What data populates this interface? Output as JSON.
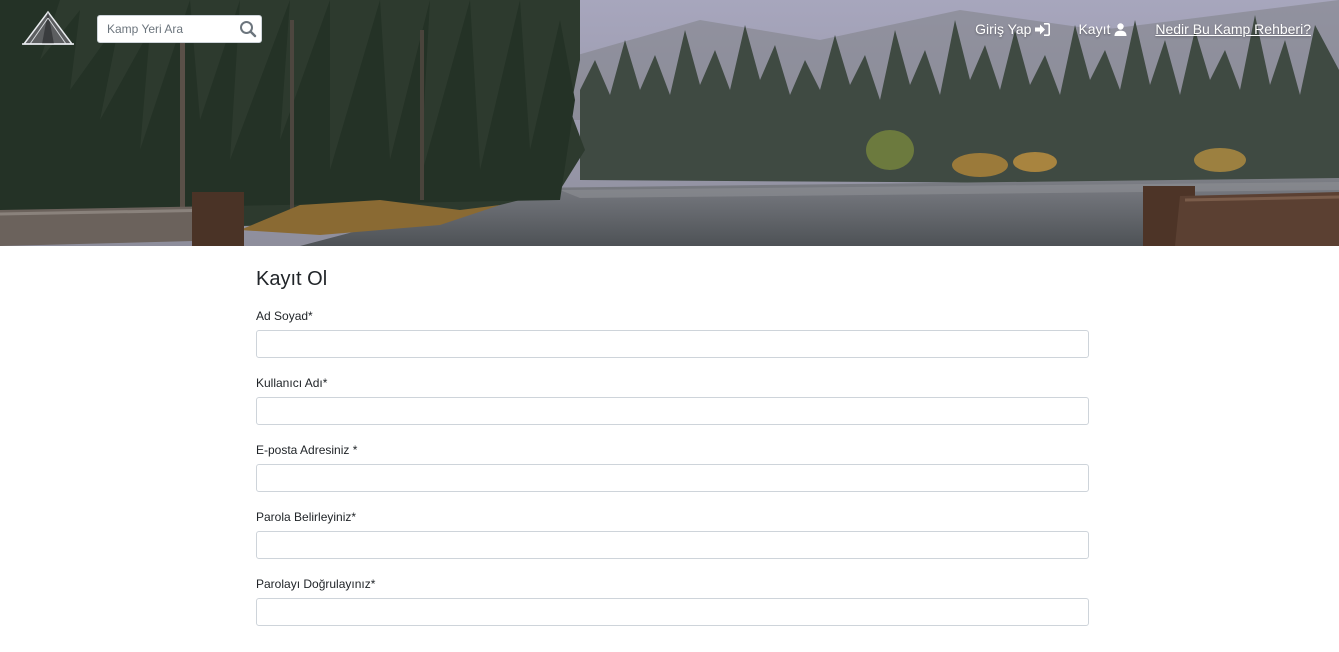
{
  "header": {
    "search": {
      "placeholder": "Kamp Yeri Ara",
      "value": ""
    },
    "nav": [
      {
        "label": "Giriş Yap",
        "icon": "sign-in-icon"
      },
      {
        "label": "Kayıt",
        "icon": "user-icon"
      },
      {
        "label": "Nedir Bu Kamp Rehberi?",
        "icon": null
      }
    ]
  },
  "form": {
    "title": "Kayıt Ol",
    "fields": [
      {
        "label": "Ad Soyad*",
        "value": ""
      },
      {
        "label": "Kullanıcı Adı*",
        "value": ""
      },
      {
        "label": "E-posta Adresiniz *",
        "value": ""
      },
      {
        "label": "Parola Belirleyiniz*",
        "value": ""
      },
      {
        "label": "Parolayı Doğrulayınız*",
        "value": ""
      }
    ]
  },
  "colors": {
    "text": "#212529",
    "input_border": "#ced4da",
    "nav_text": "#ffffff"
  }
}
